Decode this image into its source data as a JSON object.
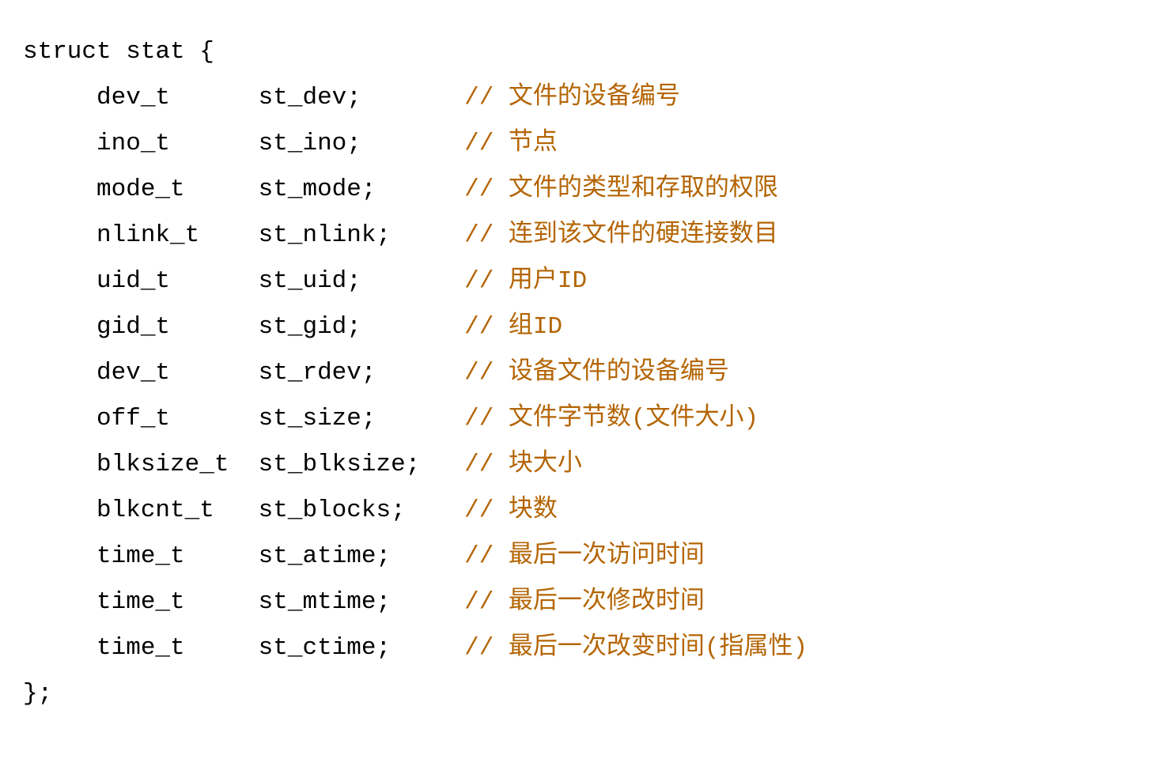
{
  "struct_keyword": "struct",
  "struct_name": "stat",
  "open_brace": "{",
  "close": "};",
  "comment_prefix": "// ",
  "indent": "     ",
  "members": [
    {
      "type": "dev_t",
      "type_pad": "      ",
      "name": "st_dev;",
      "name_pad": "       ",
      "comment": "文件的设备编号"
    },
    {
      "type": "ino_t",
      "type_pad": "      ",
      "name": "st_ino;",
      "name_pad": "       ",
      "comment": "节点"
    },
    {
      "type": "mode_t",
      "type_pad": "     ",
      "name": "st_mode;",
      "name_pad": "      ",
      "comment": "文件的类型和存取的权限"
    },
    {
      "type": "nlink_t",
      "type_pad": "    ",
      "name": "st_nlink;",
      "name_pad": "     ",
      "comment": "连到该文件的硬连接数目"
    },
    {
      "type": "uid_t",
      "type_pad": "      ",
      "name": "st_uid;",
      "name_pad": "       ",
      "comment": "用户ID"
    },
    {
      "type": "gid_t",
      "type_pad": "      ",
      "name": "st_gid;",
      "name_pad": "       ",
      "comment": "组ID"
    },
    {
      "type": "dev_t",
      "type_pad": "      ",
      "name": "st_rdev;",
      "name_pad": "      ",
      "comment": "设备文件的设备编号"
    },
    {
      "type": "off_t",
      "type_pad": "      ",
      "name": "st_size;",
      "name_pad": "      ",
      "comment": "文件字节数(文件大小)"
    },
    {
      "type": "blksize_t",
      "type_pad": "  ",
      "name": "st_blksize;",
      "name_pad": "   ",
      "comment": "块大小"
    },
    {
      "type": "blkcnt_t",
      "type_pad": "   ",
      "name": "st_blocks;",
      "name_pad": "    ",
      "comment": "块数"
    },
    {
      "type": "time_t",
      "type_pad": "     ",
      "name": "st_atime;",
      "name_pad": "     ",
      "comment": "最后一次访问时间"
    },
    {
      "type": "time_t",
      "type_pad": "     ",
      "name": "st_mtime;",
      "name_pad": "     ",
      "comment": "最后一次修改时间"
    },
    {
      "type": "time_t",
      "type_pad": "     ",
      "name": "st_ctime;",
      "name_pad": "     ",
      "comment": "最后一次改变时间(指属性)"
    }
  ]
}
